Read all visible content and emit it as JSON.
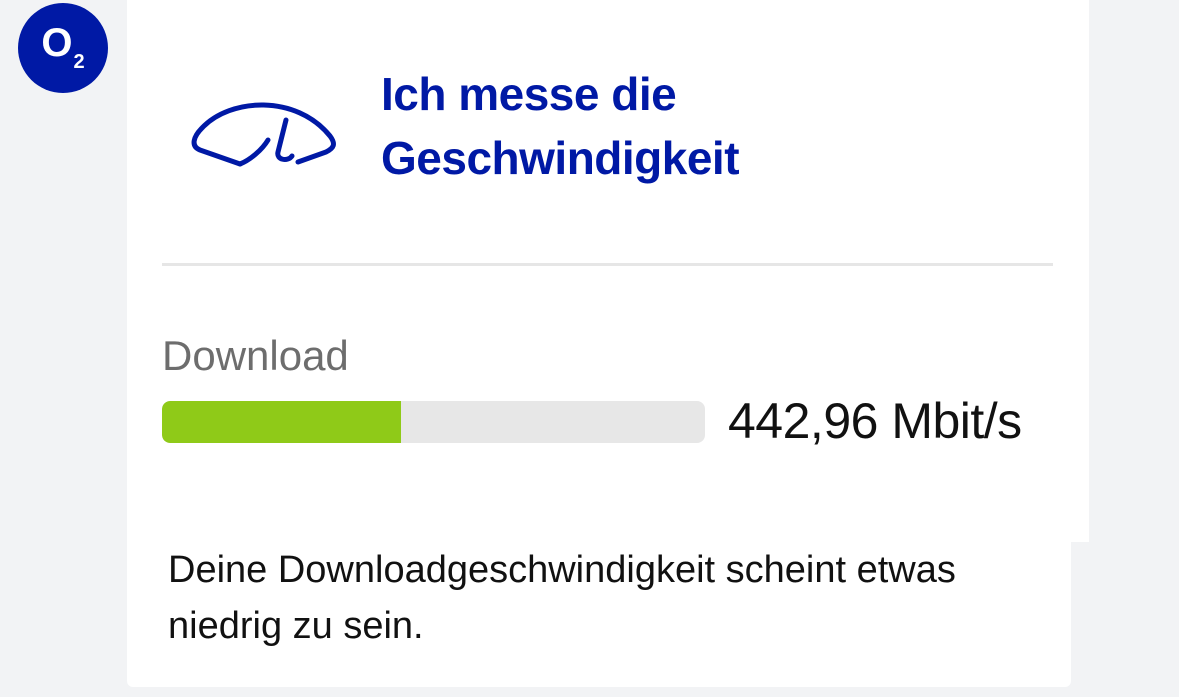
{
  "brand": {
    "logo_letter": "O",
    "logo_subscript": "2",
    "color": "#0019a5"
  },
  "header": {
    "icon": "speedometer-icon",
    "title_line1": "Ich messe die",
    "title_line2": "Geschwindigkeit"
  },
  "download": {
    "label": "Download",
    "value": "442,96 Mbit/s",
    "progress_fraction": 0.44,
    "bar_color": "#8fca18",
    "track_color": "#e7e7e7"
  },
  "result": {
    "message": "Deine Downloadgeschwindigkeit scheint etwas niedrig zu sein."
  }
}
